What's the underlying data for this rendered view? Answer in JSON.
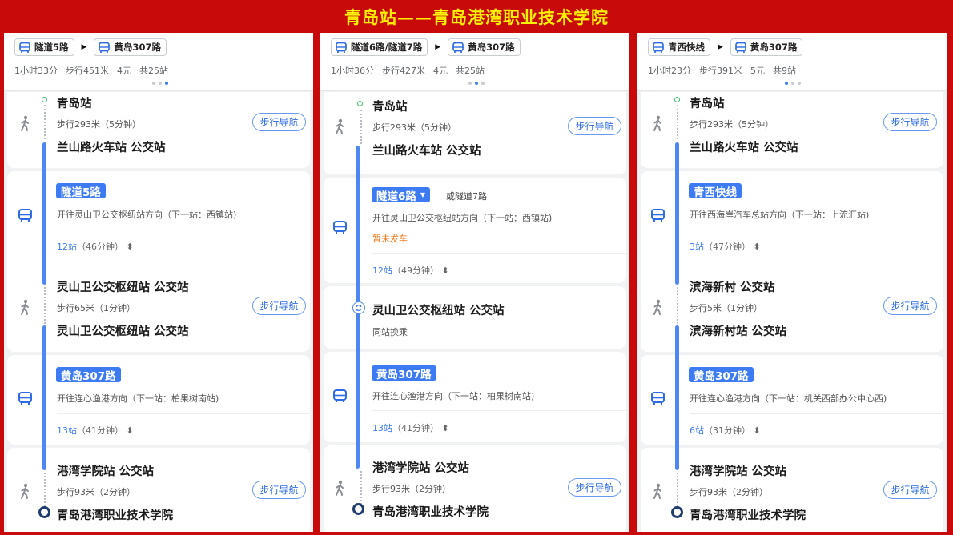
{
  "title": "青岛站——青岛港湾职业技术学院",
  "panels": [
    {
      "chips": [
        "隧道5路",
        "黄岛307路"
      ],
      "summary": {
        "time": "1小时33分",
        "walk": "步行451米",
        "price": "4元",
        "stops": "共25站"
      },
      "active_dot": 2,
      "origin": "青岛站",
      "walk1": "步行293米（5分钟）",
      "stop1": "兰山路火车站 公交站",
      "bus1": {
        "name": "隧道5路",
        "dir": "开往灵山卫公交枢纽站方向（下一站：西镇站)",
        "count": "12站",
        "time": "（46分钟）"
      },
      "stop2": "灵山卫公交枢纽站 公交站",
      "walk2": "步行65米（1分钟）",
      "stop3": "灵山卫公交枢纽站 公交站",
      "bus2": {
        "name": "黄岛307路",
        "dir": "开往连心渔港方向（下一站：柏果树南站)",
        "count": "13站",
        "time": "（41分钟）"
      },
      "stop4": "港湾学院站 公交站",
      "walk3": "步行93米（2分钟）",
      "dest": "青岛港湾职业技术学院"
    },
    {
      "chips": [
        "隧道6路/隧道7路",
        "黄岛307路"
      ],
      "summary": {
        "time": "1小时36分",
        "walk": "步行427米",
        "price": "4元",
        "stops": "共25站"
      },
      "active_dot": 1,
      "origin": "青岛站",
      "walk1": "步行293米（5分钟）",
      "stop1": "兰山路火车站 公交站",
      "bus1": {
        "name": "隧道6路",
        "alt": "或隧道7路",
        "dir": "开往灵山卫公交枢纽站方向（下一站：西镇站)",
        "status": "暂未发车",
        "count": "12站",
        "time": "（49分钟）"
      },
      "transfer_stop": "灵山卫公交枢纽站 公交站",
      "transfer_note": "同站换乘",
      "bus2": {
        "name": "黄岛307路",
        "dir": "开往连心渔港方向（下一站：柏果树南站)",
        "count": "13站",
        "time": "（41分钟）"
      },
      "stop4": "港湾学院站 公交站",
      "walk3": "步行93米（2分钟）",
      "dest": "青岛港湾职业技术学院"
    },
    {
      "chips": [
        "青西快线",
        "黄岛307路"
      ],
      "summary": {
        "time": "1小时23分",
        "walk": "步行391米",
        "price": "5元",
        "stops": "共9站"
      },
      "active_dot": 0,
      "origin": "青岛站",
      "walk1": "步行293米（5分钟）",
      "stop1": "兰山路火车站 公交站",
      "bus1": {
        "name": "青西快线",
        "dir": "开往西海岸汽车总站方向（下一站：上流汇站)",
        "count": "3站",
        "time": "（47分钟）"
      },
      "stop2": "滨海新村 公交站",
      "walk2": "步行5米（1分钟）",
      "stop3": "滨海新村站 公交站",
      "bus2": {
        "name": "黄岛307路",
        "dir": "开往连心渔港方向（下一站：机关西部办公中心西)",
        "count": "6站",
        "time": "（31分钟）"
      },
      "stop4": "港湾学院站 公交站",
      "walk3": "步行93米（2分钟）",
      "dest": "青岛港湾职业技术学院"
    }
  ],
  "nav_label": "步行导航",
  "colors": {
    "frame": "#c90a0a",
    "title": "#fff200",
    "accent": "#3d7bf4",
    "warn": "#ef7b1c",
    "start": "#3dbf6d",
    "end": "#1e3c6e"
  },
  "icons": [
    "bus-icon",
    "walk-icon",
    "play-arrow-icon",
    "transfer-icon",
    "updown-icon",
    "dropdown-icon"
  ]
}
